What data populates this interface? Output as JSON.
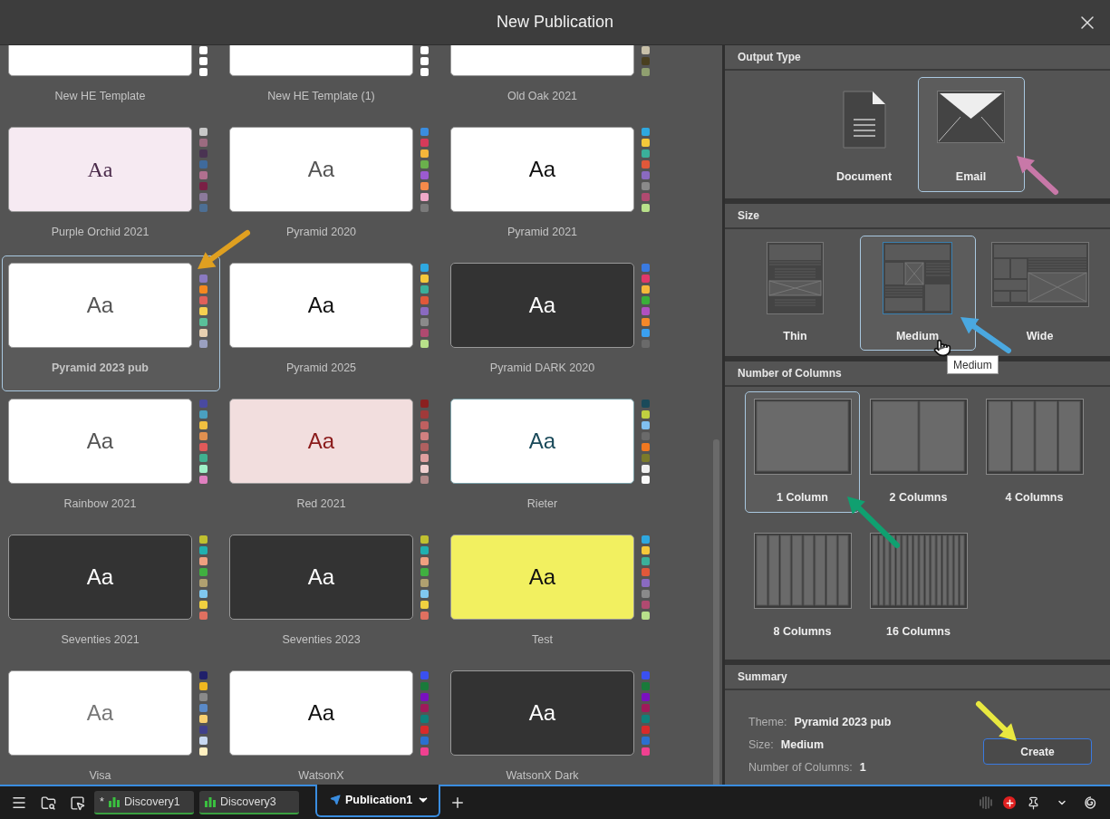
{
  "window": {
    "title": "New Publication"
  },
  "themes": [
    {
      "name": "New HE Template",
      "selected": false,
      "kind": "plain",
      "swatches": [
        {
          "color": "#ffffff"
        },
        {
          "color": "#ffffff"
        },
        {
          "color": "#ffffff"
        }
      ]
    },
    {
      "name": "New HE Template (1)",
      "selected": false,
      "kind": "plain",
      "swatches": [
        {
          "color": "#ffffff"
        },
        {
          "color": "#ffffff"
        },
        {
          "color": "#ffffff"
        }
      ]
    },
    {
      "name": "Old Oak 2021",
      "selected": false,
      "kind": "plain",
      "swatches": [
        {
          "color": "#c8c0a8"
        },
        {
          "color": "#4a4020"
        },
        {
          "color": "#90a070"
        }
      ]
    },
    {
      "name": "Purple Orchid 2021",
      "selected": false,
      "kind": "orchid",
      "sample": "Aa",
      "swatches": [
        {
          "color": "#c8c8c8"
        },
        {
          "color": "#9c6b80"
        },
        {
          "color": "#4a3352"
        },
        {
          "color": "#3f6a9c"
        },
        {
          "color": "#b0708f"
        },
        {
          "color": "#7a2045"
        },
        {
          "color": "#8c7a9c"
        },
        {
          "color": "#4d6f94"
        }
      ]
    },
    {
      "name": "Pyramid 2020",
      "selected": false,
      "kind": "plain",
      "sample": "Aa",
      "swatches": [
        {
          "color": "#3a8de0"
        },
        {
          "color": "#d63a5a"
        },
        {
          "color": "#f5b53a"
        },
        {
          "color": "#6ab04c"
        },
        {
          "color": "#9b5bd0"
        },
        {
          "color": "#f58a4a"
        },
        {
          "color": "#f0a8c8"
        },
        {
          "color": "#7a7a7a"
        }
      ]
    },
    {
      "name": "Pyramid 2021",
      "selected": false,
      "kind": "bold",
      "sample": "Aa",
      "swatches": [
        {
          "color": "#2ea8e0"
        },
        {
          "color": "#f5c83a"
        },
        {
          "color": "#3ab09a"
        },
        {
          "color": "#e0583a"
        },
        {
          "color": "#8a6ac0"
        },
        {
          "color": "#8a8a8a"
        },
        {
          "color": "#b04a70"
        },
        {
          "color": "#b8e08a"
        }
      ]
    },
    {
      "name": "Pyramid 2023 pub",
      "selected": true,
      "kind": "plain",
      "sample": "Aa",
      "swatches": [
        {
          "color": "#8a7ac0"
        },
        {
          "color": "#f5881f"
        },
        {
          "color": "#e0605a"
        },
        {
          "color": "#f5d050"
        },
        {
          "color": "#5ac09a"
        },
        {
          "color": "#e8d0b0"
        },
        {
          "color": "#9aa0c0"
        }
      ]
    },
    {
      "name": "Pyramid 2025",
      "selected": false,
      "kind": "bold",
      "sample": "Aa",
      "swatches": [
        {
          "color": "#2ea8e0"
        },
        {
          "color": "#f5c83a"
        },
        {
          "color": "#3ab09a"
        },
        {
          "color": "#e0583a"
        },
        {
          "color": "#8a6ac0"
        },
        {
          "color": "#8a8a8a"
        },
        {
          "color": "#b04a70"
        },
        {
          "color": "#b8e08a"
        }
      ]
    },
    {
      "name": "Pyramid DARK 2020",
      "selected": false,
      "kind": "dark",
      "sample": "Aa",
      "swatches": [
        {
          "color": "#3a7ae0"
        },
        {
          "color": "#e0386a"
        },
        {
          "color": "#f5b83a"
        },
        {
          "color": "#3ab03a"
        },
        {
          "color": "#b050c0"
        },
        {
          "color": "#f5882a"
        },
        {
          "color": "#3aa0f0"
        },
        {
          "color": "#6a6a6a"
        }
      ]
    },
    {
      "name": "Rainbow 2021",
      "selected": false,
      "kind": "plain",
      "sample": "Aa",
      "swatches": [
        {
          "color": "#4a4aa0"
        },
        {
          "color": "#4aa0c0"
        },
        {
          "color": "#f0c040"
        },
        {
          "color": "#e09050"
        },
        {
          "color": "#e05a5a"
        },
        {
          "color": "#40b090"
        },
        {
          "color": "#a0f0c8"
        },
        {
          "color": "#e080c0"
        }
      ]
    },
    {
      "name": "Red 2021",
      "selected": false,
      "kind": "blush",
      "sample": "Aa",
      "swatches": [
        {
          "color": "#8a2020"
        },
        {
          "color": "#a03a3a"
        },
        {
          "color": "#c06060"
        },
        {
          "color": "#d08080"
        },
        {
          "color": "#b06060"
        },
        {
          "color": "#e0a0a0"
        },
        {
          "color": "#f0d0d0"
        },
        {
          "color": "#b08888"
        }
      ]
    },
    {
      "name": "Rieter",
      "selected": false,
      "kind": "teal",
      "sample": "Aa",
      "swatches": [
        {
          "color": "#1a4a5a"
        },
        {
          "color": "#c0d040"
        },
        {
          "color": "#80c0f0"
        },
        {
          "color": "#6a6a6a"
        },
        {
          "color": "#f07820"
        },
        {
          "color": "#7a7a2a"
        },
        {
          "color": "#f0f0f0"
        },
        {
          "color": "#f8f8f8"
        }
      ]
    },
    {
      "name": "Seventies 2021",
      "selected": false,
      "kind": "dark",
      "sample": "Aa",
      "swatches": [
        {
          "color": "#c0c030"
        },
        {
          "color": "#20b0b0"
        },
        {
          "color": "#f0a080"
        },
        {
          "color": "#40b040"
        },
        {
          "color": "#b0a070"
        },
        {
          "color": "#80c8f0"
        },
        {
          "color": "#f0d040"
        },
        {
          "color": "#e07060"
        }
      ]
    },
    {
      "name": "Seventies 2023",
      "selected": false,
      "kind": "dark",
      "sample": "Aa",
      "swatches": [
        {
          "color": "#c0c030"
        },
        {
          "color": "#20b0b0"
        },
        {
          "color": "#f0a080"
        },
        {
          "color": "#40b040"
        },
        {
          "color": "#b0a070"
        },
        {
          "color": "#80c8f0"
        },
        {
          "color": "#f0d040"
        },
        {
          "color": "#e07060"
        }
      ]
    },
    {
      "name": "Test",
      "selected": false,
      "kind": "yellow",
      "sample": "Aa",
      "swatches": [
        {
          "color": "#2ea8e0"
        },
        {
          "color": "#f5c83a"
        },
        {
          "color": "#3ab09a"
        },
        {
          "color": "#e0583a"
        },
        {
          "color": "#8a6ac0"
        },
        {
          "color": "#8a8a8a"
        },
        {
          "color": "#b04a70"
        },
        {
          "color": "#b8e08a"
        }
      ]
    },
    {
      "name": "Visa",
      "selected": false,
      "kind": "light",
      "sample": "Aa",
      "swatches": [
        {
          "color": "#20206a"
        },
        {
          "color": "#f0b820"
        },
        {
          "color": "#8a8a8a"
        },
        {
          "color": "#5a8ac8"
        },
        {
          "color": "#f8d070"
        },
        {
          "color": "#40408a"
        },
        {
          "color": "#c8d8f0"
        },
        {
          "color": "#fff0c0"
        }
      ]
    },
    {
      "name": "WatsonX",
      "selected": false,
      "kind": "bold",
      "sample": "Aa",
      "swatches": [
        {
          "color": "#3a50f0"
        },
        {
          "color": "#1a7a3a"
        },
        {
          "color": "#7a10c0"
        },
        {
          "color": "#a01a5a"
        },
        {
          "color": "#10807a"
        },
        {
          "color": "#d82a2a"
        },
        {
          "color": "#2a70d0"
        },
        {
          "color": "#f04090"
        }
      ]
    },
    {
      "name": "WatsonX Dark",
      "selected": false,
      "kind": "dark",
      "sample": "Aa",
      "swatches": [
        {
          "color": "#3a50f0"
        },
        {
          "color": "#1a7a3a"
        },
        {
          "color": "#7a10c0"
        },
        {
          "color": "#a01a5a"
        },
        {
          "color": "#10807a"
        },
        {
          "color": "#d82a2a"
        },
        {
          "color": "#2a70d0"
        },
        {
          "color": "#f04090"
        }
      ]
    }
  ],
  "output_type": {
    "title": "Output Type",
    "options": [
      {
        "label": "Document",
        "kind": "document",
        "selected": false
      },
      {
        "label": "Email",
        "kind": "email",
        "selected": true
      }
    ]
  },
  "size": {
    "title": "Size",
    "options": [
      {
        "label": "Thin",
        "kind": "thin",
        "selected": false
      },
      {
        "label": "Medium",
        "kind": "medium",
        "selected": true
      },
      {
        "label": "Wide",
        "kind": "wide",
        "selected": false
      }
    ],
    "tooltip": "Medium"
  },
  "columns": {
    "title": "Number of Columns",
    "options": [
      {
        "label": "1 Column",
        "kind": "one",
        "selected": true
      },
      {
        "label": "2 Columns",
        "kind": "two",
        "selected": false
      },
      {
        "label": "4 Columns",
        "kind": "four",
        "selected": false
      },
      {
        "label": "8 Columns",
        "kind": "eight",
        "selected": false
      },
      {
        "label": "16 Columns",
        "kind": "sixteen",
        "selected": false
      }
    ]
  },
  "summary": {
    "title": "Summary",
    "rows": [
      {
        "label": "Theme:",
        "value": "Pyramid 2023 pub"
      },
      {
        "label": "Size:",
        "value": "Medium"
      },
      {
        "label": "Number of Columns:",
        "value": "1"
      }
    ],
    "button": "Create"
  },
  "taskbar": {
    "tabs": [
      {
        "label": "Discovery1",
        "prefix": "*",
        "kind": "discovery",
        "selected": false
      },
      {
        "label": "Discovery3",
        "kind": "discovery",
        "selected": false
      },
      {
        "label": "Publication1",
        "kind": "publication",
        "selected": true
      }
    ]
  },
  "annotations": [
    {
      "color": "#e0a020"
    },
    {
      "color": "#c878a8"
    },
    {
      "color": "#4aa8e0"
    },
    {
      "color": "#10a070"
    },
    {
      "color": "#e8e840"
    }
  ]
}
